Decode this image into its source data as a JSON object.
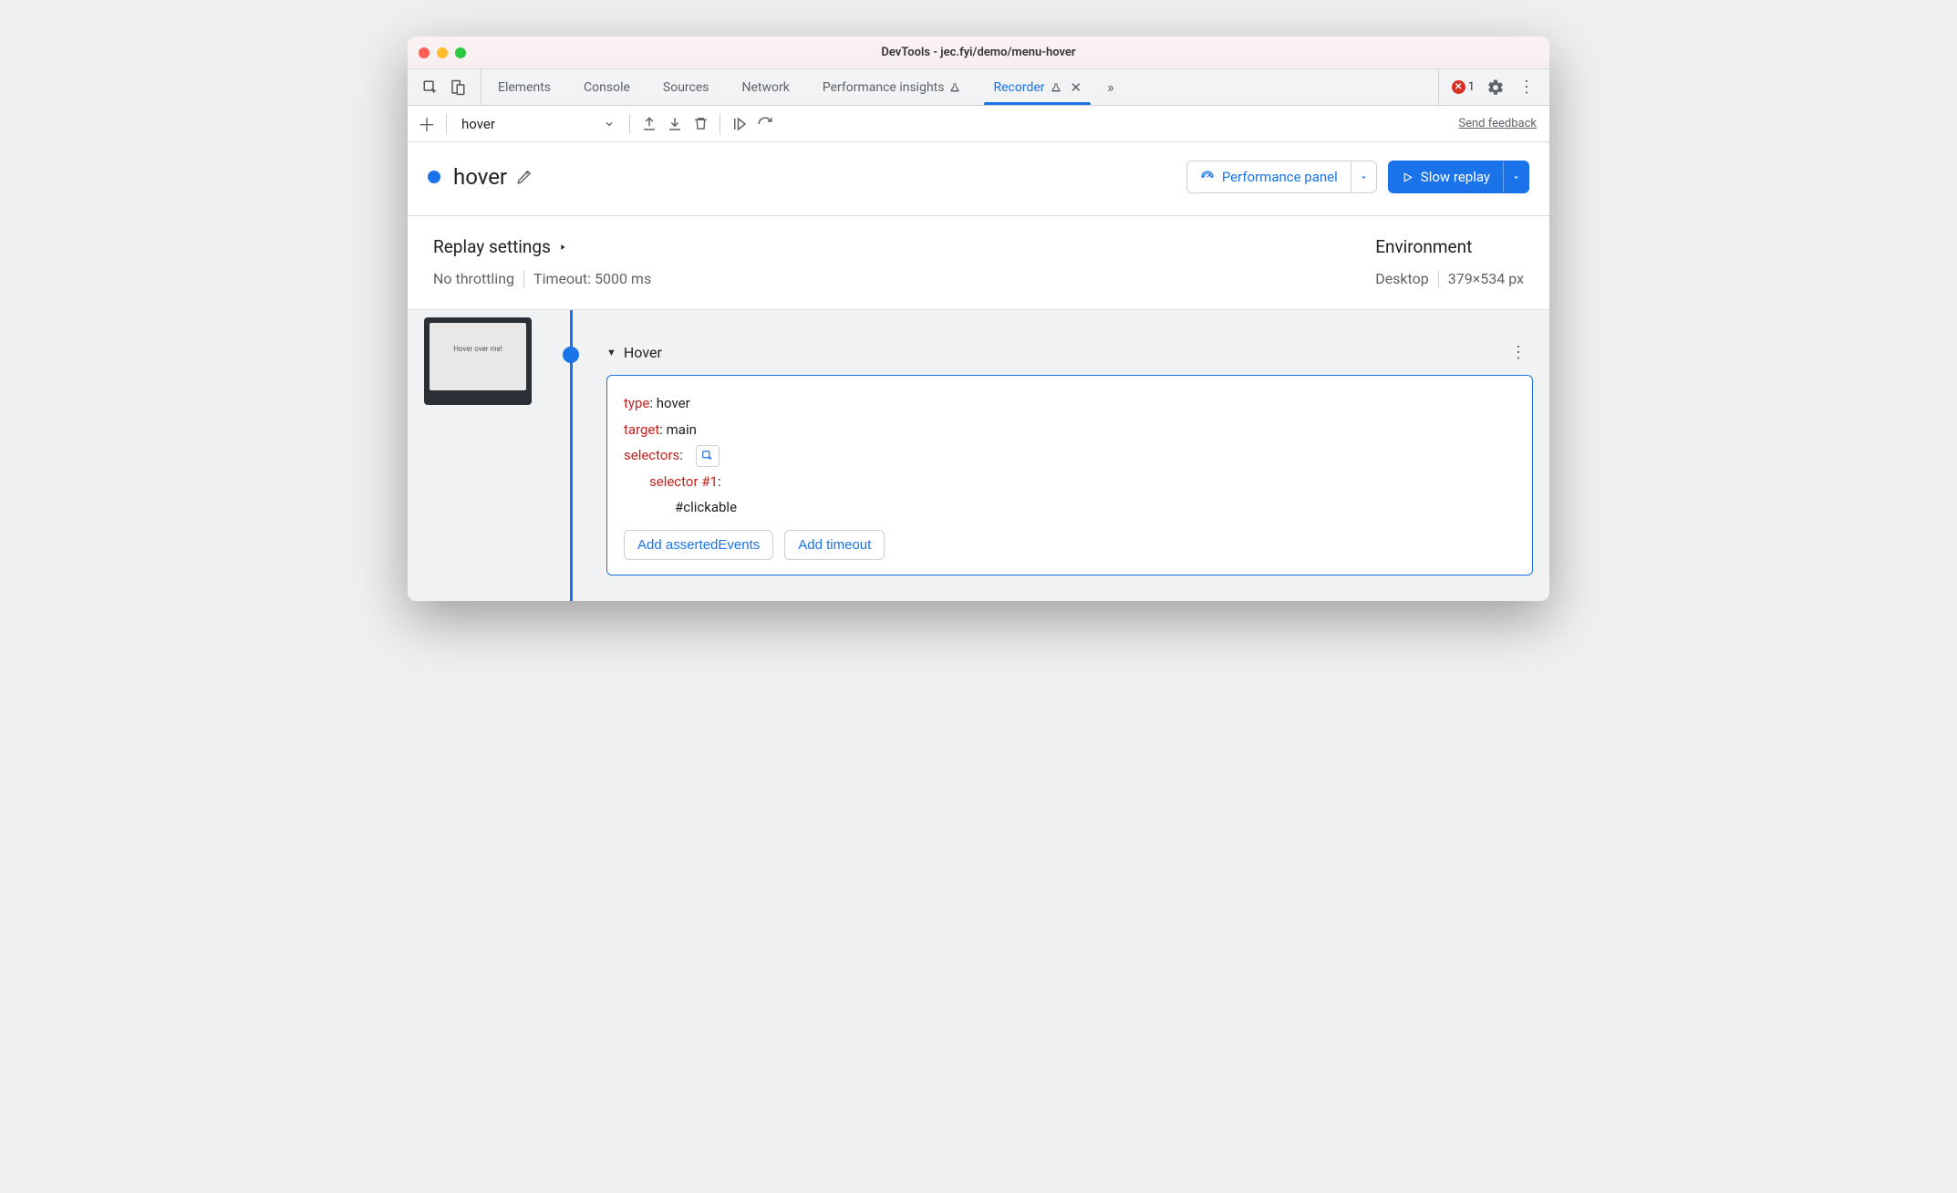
{
  "window": {
    "title": "DevTools - jec.fyi/demo/menu-hover"
  },
  "tabs": {
    "items": [
      "Elements",
      "Console",
      "Sources",
      "Network",
      "Performance insights",
      "Recorder"
    ],
    "active": "Recorder"
  },
  "errors": {
    "count": "1"
  },
  "toolbar": {
    "recording_selected": "hover",
    "feedback_label": "Send feedback"
  },
  "recorder": {
    "title": "hover",
    "perf_button": "Performance panel",
    "replay_button": "Slow replay"
  },
  "settings": {
    "replay_title": "Replay settings",
    "throttling": "No throttling",
    "timeout": "Timeout: 5000 ms",
    "env_title": "Environment",
    "device": "Desktop",
    "viewport": "379×534 px"
  },
  "thumbnail": {
    "text": "Hover over me!"
  },
  "step": {
    "name": "Hover",
    "kv": {
      "type_key": "type",
      "type_val": "hover",
      "target_key": "target",
      "target_val": "main",
      "selectors_key": "selectors",
      "selector1_key": "selector #1",
      "selector1_val": "#clickable"
    },
    "actions": {
      "asserted": "Add assertedEvents",
      "timeout": "Add timeout"
    }
  }
}
